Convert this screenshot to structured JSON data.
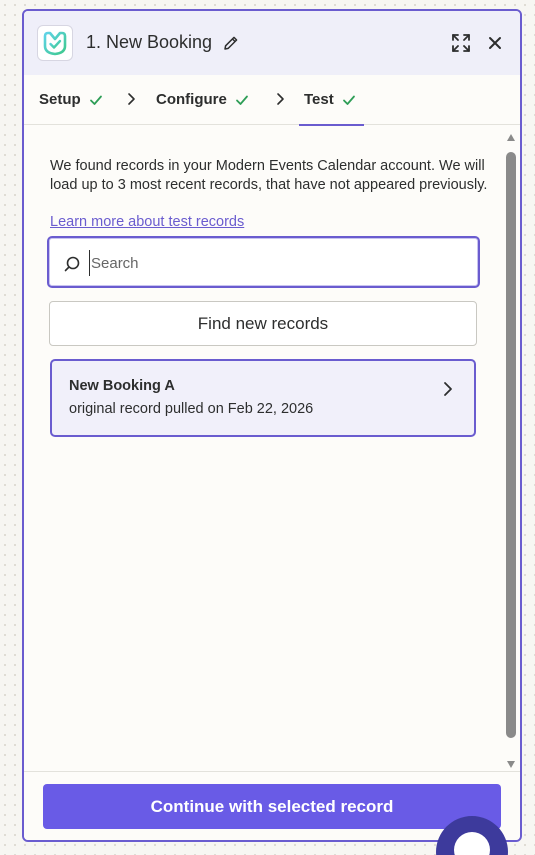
{
  "header": {
    "title": "1. New Booking",
    "logo_icon": "modern-events-calendar-logo",
    "edit_icon": "pencil-icon",
    "expand_icon": "expand-icon",
    "close_icon": "close-icon"
  },
  "tabs": [
    {
      "label": "Setup",
      "complete": true
    },
    {
      "label": "Configure",
      "complete": true
    },
    {
      "label": "Test",
      "complete": true,
      "active": true
    }
  ],
  "content": {
    "intro": "We found records in your Modern Events Calendar account. We will load up to 3 most recent records, that have not appeared previously.",
    "learn_link": "Learn more about test records",
    "search": {
      "placeholder": "Search",
      "value": ""
    },
    "find_button": "Find new records",
    "records": [
      {
        "title": "New Booking A",
        "subtitle": "original record pulled on Feb 22, 2026",
        "selected": true
      }
    ]
  },
  "footer": {
    "continue_button": "Continue with selected record"
  },
  "colors": {
    "accent": "#6a5ccf",
    "primary_button": "#695be6",
    "check_green": "#2e9e57",
    "header_bg": "#efeff9"
  }
}
